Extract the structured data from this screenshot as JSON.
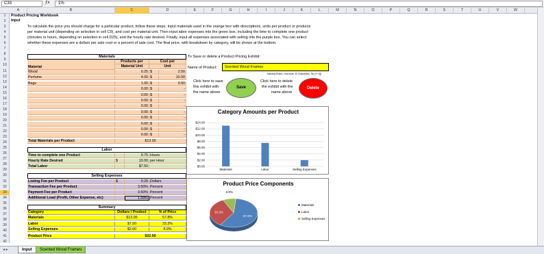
{
  "formula_bar": {
    "name_box": "C33",
    "formula": "1%"
  },
  "columns": [
    "A",
    "B",
    "C",
    "D",
    "E",
    "F",
    "G",
    "H",
    "I",
    "J",
    "K",
    "L",
    "M",
    "N",
    "O",
    "P",
    "Q",
    "R",
    "S",
    "T",
    "U",
    "V",
    "W"
  ],
  "rows": [
    "1",
    "2",
    "3",
    "4",
    "5",
    "6",
    "7",
    "8",
    "9",
    "10",
    "11",
    "12",
    "13",
    "14",
    "15",
    "16",
    "17",
    "18",
    "19",
    "20",
    "21",
    "22",
    "23",
    "24",
    "25",
    "26",
    "27",
    "28",
    "29",
    "30",
    "31",
    "32",
    "33",
    "34",
    "35",
    "36",
    "37",
    "38",
    "39",
    "40",
    "41",
    "42"
  ],
  "title": "Product Pricing Workbook",
  "subtitle": "Input",
  "instructions": [
    "To calculate the price you should charge for a particular product, follow these steps. Input materials used in the orange box with descriptions, units per product or products",
    "per material unit (depending on selection in cell C9), and cost per material unit. Then input labor expenses into the green box, including the time to complete one product",
    "(minutes or hours, depending on selection in cell D25), and the hourly rate desired. Finally, input all expenses associated with selling into the purple box. You can select",
    "whether these expenses are a dollars per sale cost or a percent of sale cost. The final price, with breakdown by category, will be shown at the bottom."
  ],
  "materials": {
    "header": "Materials",
    "col_material": "Material",
    "col_products_1": "Products per",
    "col_products_2": "Material Unit",
    "col_cost_1": "Cost per",
    "col_cost_2": "Unit",
    "items": [
      {
        "name": "Wood",
        "qty": "0.25",
        "cur": "$",
        "cost": "2.50"
      },
      {
        "name": "Perfume",
        "qty": "4.00",
        "cur": "$",
        "cost": "10.00"
      },
      {
        "name": "Bags",
        "qty": "1.00",
        "cur": "$",
        "cost": "0.50"
      },
      {
        "name": "",
        "qty": "0.00",
        "cur": "$",
        "cost": "-"
      },
      {
        "name": "",
        "qty": "0.00",
        "cur": "$",
        "cost": "-"
      },
      {
        "name": "",
        "qty": "0.00",
        "cur": "$",
        "cost": "-"
      },
      {
        "name": "",
        "qty": "0.00",
        "cur": "$",
        "cost": "-"
      },
      {
        "name": "",
        "qty": "0.00",
        "cur": "$",
        "cost": "-"
      },
      {
        "name": "",
        "qty": "0.00",
        "cur": "$",
        "cost": "-"
      },
      {
        "name": "",
        "qty": "0.00",
        "cur": "$",
        "cost": "-"
      },
      {
        "name": "",
        "qty": "0.00",
        "cur": "$",
        "cost": "-"
      },
      {
        "name": "",
        "qty": "0.00",
        "cur": "$",
        "cost": "-"
      }
    ],
    "total_label": "Total Materials per Product",
    "total_value": "$13.00"
  },
  "labor": {
    "header": "Labor",
    "rows": [
      {
        "label": "Time to complete one Product",
        "cur": "",
        "value": "0.75",
        "unit": "Hours"
      },
      {
        "label": "Hourly Rate Desired",
        "cur": "$",
        "value": "10.00",
        "unit": "per Hour"
      },
      {
        "label": "Total Labor",
        "cur": "",
        "value": "$7.50",
        "unit": ""
      }
    ]
  },
  "selling": {
    "header": "Selling Expenses",
    "rows": [
      {
        "label": "Listing Fee per Product",
        "cur": "$",
        "value": "0.20",
        "unit": "Dollars"
      },
      {
        "label": "Transaction Fee per Product",
        "cur": "",
        "value": "3.50%",
        "unit": "Percent"
      },
      {
        "label": "Payment Fee per Product",
        "cur": "",
        "value": "3.50%",
        "unit": "Percent"
      },
      {
        "label": "Additional Load (Profit, Other Expense, etc)",
        "cur": "",
        "value": "1.00%",
        "unit": "Percent"
      }
    ]
  },
  "summary": {
    "header": "Summary",
    "col_category": "Category",
    "col_dollars": "Dollars / Product",
    "col_pct": "% of Price",
    "rows": [
      {
        "cat": "Materials",
        "dollars": "$13.00",
        "pct": "57.8%"
      },
      {
        "cat": "Labor",
        "dollars": "$7.50",
        "pct": "33.3%"
      },
      {
        "cat": "Selling Expenses",
        "dollars": "$2.00",
        "pct": "8.9%"
      }
    ],
    "price_label": "Product Price",
    "price_value": "$22.50"
  },
  "exhibit": {
    "heading": "To Save or delete a Product Pricing Exhibit:",
    "name_label": "Name of Product:",
    "name_value": "Scented Wood Frames",
    "warning": "Naming Rules: Less than 32 Characters, No (*/:?[])",
    "save_text_1": "Click here to save",
    "save_text_2": "this exhibit with",
    "save_text_3": "the name above",
    "save_button": "Save",
    "delete_text_1": "Click here to delete",
    "delete_text_2": "the exhibit with the",
    "delete_text_3": "name above",
    "delete_button": "Delete",
    "save_color": "#92d050",
    "delete_color": "#ff0000"
  },
  "chart_data": [
    {
      "type": "bar",
      "title": "Category Amounts per Product",
      "categories": [
        "Materials",
        "Labor",
        "Selling Expenses"
      ],
      "values": [
        13.0,
        7.5,
        2.0
      ],
      "ylim": [
        0,
        14
      ],
      "yticks": [
        "$0.00",
        "$2.00",
        "$4.00",
        "$6.00",
        "$8.00",
        "$10.00",
        "$12.00",
        "$14.00"
      ],
      "color": "#4f81bd",
      "grid": true
    },
    {
      "type": "pie",
      "title": "Product Price Components",
      "categories": [
        "Materials",
        "Labor",
        "Selling Expenses"
      ],
      "values": [
        57.8,
        33.3,
        8.9
      ],
      "labels": [
        "57.8%",
        "33.3%",
        "8.9%"
      ],
      "colors": [
        "#4f81bd",
        "#c0504d",
        "#9bbb59"
      ],
      "legend": "right"
    }
  ],
  "sheet_tabs": [
    {
      "label": "Input",
      "active": true
    },
    {
      "label": "Scented Wood Frames",
      "active": false
    }
  ]
}
